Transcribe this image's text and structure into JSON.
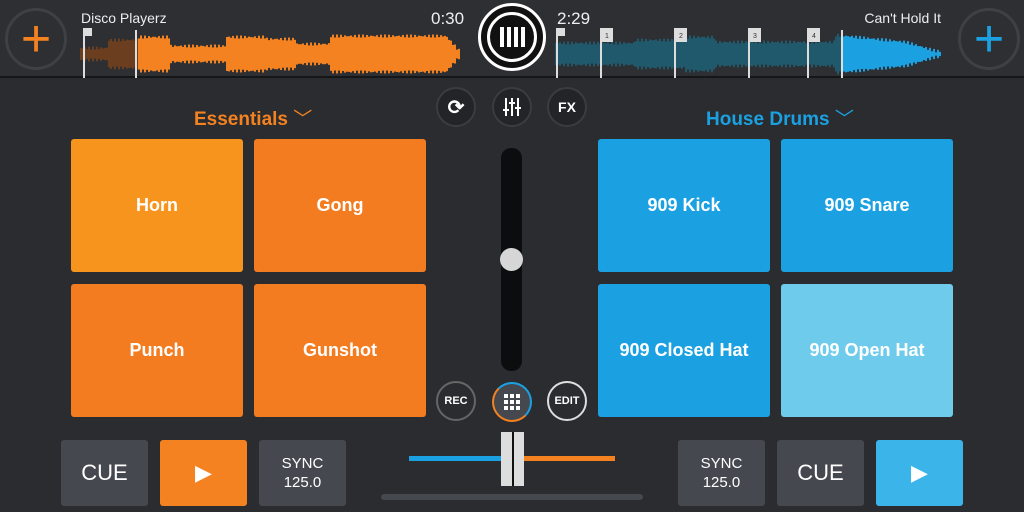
{
  "deck_left": {
    "track_title": "Disco Playerz",
    "time": "0:30",
    "color": "#f58220",
    "sample_bank": "Essentials",
    "pads": [
      "Horn",
      "Gong",
      "Punch",
      "Gunshot"
    ],
    "cue": "CUE",
    "sync": "SYNC",
    "bpm": "125.0"
  },
  "deck_right": {
    "track_title": "Can't Hold It",
    "time": "2:29",
    "color": "#1ba1e2",
    "sample_bank": "House Drums",
    "pads": [
      "909 Kick",
      "909 Snare",
      "909 Closed Hat",
      "909 Open Hat"
    ],
    "cue_markers": [
      "1",
      "2",
      "3",
      "4"
    ],
    "cue": "CUE",
    "sync": "SYNC",
    "bpm": "125.0"
  },
  "center": {
    "fx": "FX",
    "rec": "REC",
    "edit": "EDIT",
    "volume_level": 0.5,
    "crossfader_position": 0.5
  },
  "icons": {
    "add": "plus-icon",
    "pause": "pause-icon",
    "sync": "sync-icon",
    "mixer": "mixer-sliders-icon",
    "grid": "grid-icon",
    "play": "play-icon",
    "dropdown": "chevron-down-icon"
  }
}
